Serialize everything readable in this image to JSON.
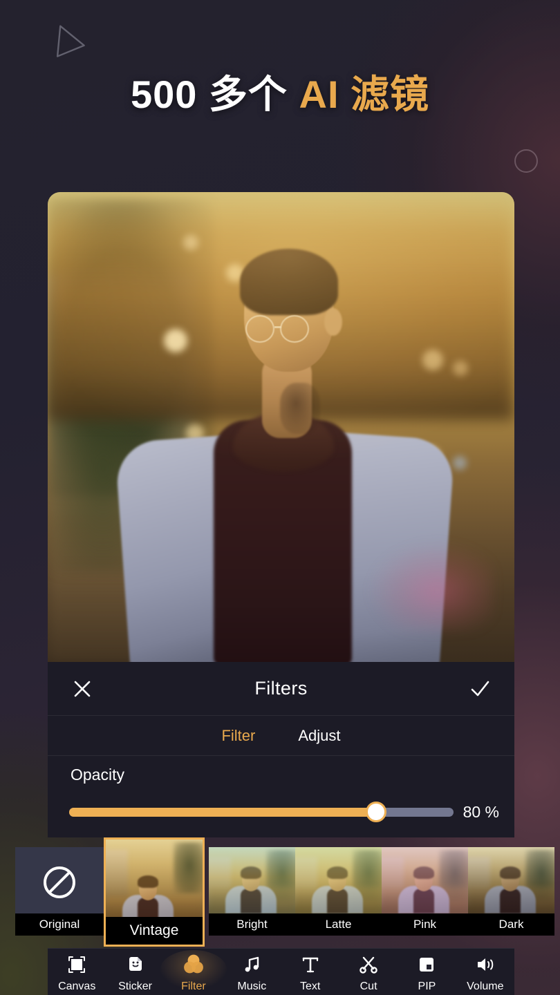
{
  "promo": {
    "headline_white": "500 多个 ",
    "headline_gold": "AI 滤镜",
    "decor_triangle": "play-triangle-outline",
    "decor_circle": "circle-outline"
  },
  "editor": {
    "header": {
      "title": "Filters",
      "close_icon": "close-icon",
      "confirm_icon": "check-icon"
    },
    "tabs": [
      {
        "label": "Filter",
        "active": true
      },
      {
        "label": "Adjust",
        "active": false
      }
    ],
    "opacity": {
      "label": "Opacity",
      "value": 80,
      "value_text": "80 %",
      "min": 0,
      "max": 100
    },
    "filters": [
      {
        "label": "Original",
        "selected": false,
        "icon": "no-filter-icon"
      },
      {
        "label": "Vintage",
        "selected": true
      },
      {
        "label": "Bright",
        "selected": false
      },
      {
        "label": "Latte",
        "selected": false
      },
      {
        "label": "Pink",
        "selected": false
      },
      {
        "label": "Dark",
        "selected": false
      }
    ],
    "nav": [
      {
        "label": "Canvas",
        "icon": "canvas-icon",
        "active": false
      },
      {
        "label": "Sticker",
        "icon": "sticker-icon",
        "active": false
      },
      {
        "label": "Filter",
        "icon": "filter-icon",
        "active": true
      },
      {
        "label": "Music",
        "icon": "music-icon",
        "active": false
      },
      {
        "label": "Text",
        "icon": "text-icon",
        "active": false
      },
      {
        "label": "Cut",
        "icon": "scissors-icon",
        "active": false
      },
      {
        "label": "PIP",
        "icon": "pip-icon",
        "active": false
      },
      {
        "label": "Volume",
        "icon": "volume-icon",
        "active": false
      }
    ]
  },
  "colors": {
    "accent": "#e9a94d",
    "slider_fill": "#eeb054",
    "panel": "#1c1b26",
    "track": "#737790",
    "text": "#ffffff"
  }
}
